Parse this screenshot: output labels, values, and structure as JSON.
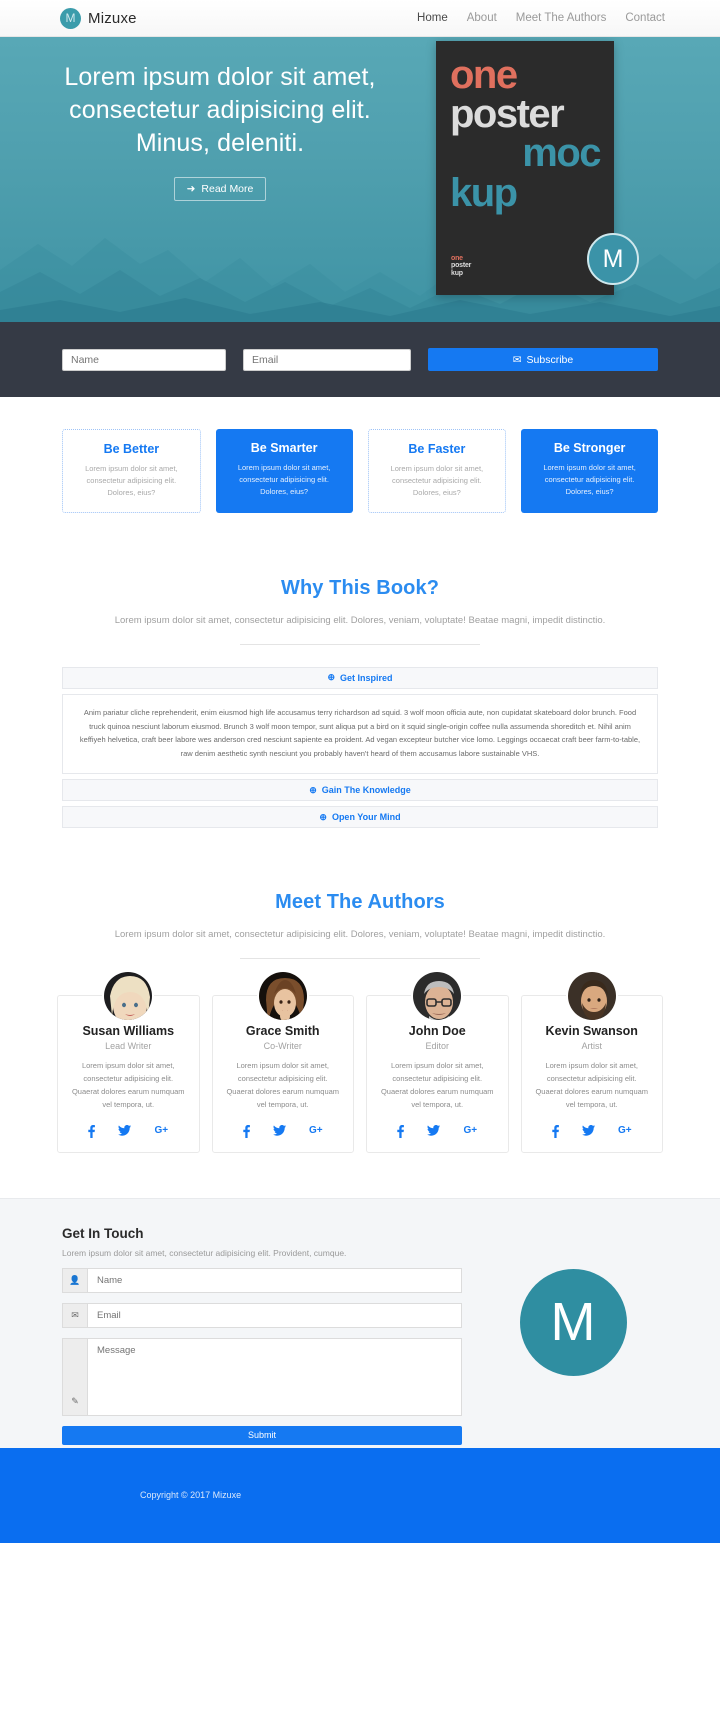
{
  "navbar": {
    "brand": "Mizuxe",
    "brand_initial": "M",
    "links": [
      {
        "label": "Home",
        "active": true
      },
      {
        "label": "About",
        "active": false
      },
      {
        "label": "Meet The Authors",
        "active": false
      },
      {
        "label": "Contact",
        "active": false
      }
    ]
  },
  "hero": {
    "title": "Lorem ipsum dolor sit amet, consectetur adipisicing elit. Minus, deleniti.",
    "cta": "Read More",
    "cta_icon": "arrow-right-icon",
    "poster": {
      "line1": "one",
      "line2": "poster",
      "line3": "moc",
      "line4": "kup",
      "mark1": "one",
      "mark2": "poster",
      "mark3": "kup",
      "badge": "M",
      "bg_color": "#2b2b2b",
      "accent_red": "#e0705e",
      "accent_teal": "#3b93a8"
    }
  },
  "subscribe": {
    "name_placeholder": "Name",
    "email_placeholder": "Email",
    "button_label": "Subscribe",
    "button_icon": "envelope-open-icon",
    "bar_color": "#353a45",
    "button_color": "#1579f2"
  },
  "features": [
    {
      "title": "Be Better",
      "text": "Lorem ipsum dolor sit amet, consectetur adipisicing elit. Dolores, eius?",
      "style": "light"
    },
    {
      "title": "Be Smarter",
      "text": "Lorem ipsum dolor sit amet, consectetur adipisicing elit. Dolores, eius?",
      "style": "solid"
    },
    {
      "title": "Be Faster",
      "text": "Lorem ipsum dolor sit amet, consectetur adipisicing elit. Dolores, eius?",
      "style": "light"
    },
    {
      "title": "Be Stronger",
      "text": "Lorem ipsum dolor sit amet, consectetur adipisicing elit. Dolores, eius?",
      "style": "solid"
    }
  ],
  "why": {
    "heading": "Why This Book?",
    "subtext": "Lorem ipsum dolor sit amet, consectetur adipisicing elit. Dolores, veniam, voluptate! Beatae magni, impedit distinctio.",
    "accordion": [
      {
        "label": "Get Inspired",
        "icon": "plus-circle-icon",
        "open": true,
        "body": "Anim pariatur cliche reprehenderit, enim eiusmod high life accusamus terry richardson ad squid. 3 wolf moon officia aute, non cupidatat skateboard dolor brunch. Food truck quinoa nesciunt laborum eiusmod. Brunch 3 wolf moon tempor, sunt aliqua put a bird on it squid single-origin coffee nulla assumenda shoreditch et. Nihil anim keffiyeh helvetica, craft beer labore wes anderson cred nesciunt sapiente ea proident. Ad vegan excepteur butcher vice lomo. Leggings occaecat craft beer farm-to-table, raw denim aesthetic synth nesciunt you probably haven't heard of them accusamus labore sustainable VHS."
      },
      {
        "label": "Gain The Knowledge",
        "icon": "plus-circle-icon",
        "open": false,
        "body": ""
      },
      {
        "label": "Open Your Mind",
        "icon": "plus-circle-icon",
        "open": false,
        "body": ""
      }
    ]
  },
  "authors_section": {
    "heading": "Meet The Authors",
    "subtext": "Lorem ipsum dolor sit amet, consectetur adipisicing elit. Dolores, veniam, voluptate! Beatae magni, impedit distinctio.",
    "authors": [
      {
        "name": "Susan Williams",
        "role": "Lead Writer",
        "bio": "Lorem ipsum dolor sit amet, consectetur adipisicing elit. Quaerat dolores earum numquam vel tempora, ut.",
        "avatar": "blonde-woman-avatar",
        "socials": [
          "facebook-icon",
          "twitter-icon",
          "google-plus-icon"
        ]
      },
      {
        "name": "Grace Smith",
        "role": "Co-Writer",
        "bio": "Lorem ipsum dolor sit amet, consectetur adipisicing elit. Quaerat dolores earum numquam vel tempora, ut.",
        "avatar": "brunette-woman-avatar",
        "socials": [
          "facebook-icon",
          "twitter-icon",
          "google-plus-icon"
        ]
      },
      {
        "name": "John Doe",
        "role": "Editor",
        "bio": "Lorem ipsum dolor sit amet, consectetur adipisicing elit. Quaerat dolores earum numquam vel tempora, ut.",
        "avatar": "older-man-glasses-avatar",
        "socials": [
          "facebook-icon",
          "twitter-icon",
          "google-plus-icon"
        ]
      },
      {
        "name": "Kevin Swanson",
        "role": "Artist",
        "bio": "Lorem ipsum dolor sit amet, consectetur adipisicing elit. Quaerat dolores earum numquam vel tempora, ut.",
        "avatar": "bearded-man-avatar",
        "socials": [
          "facebook-icon",
          "twitter-icon",
          "google-plus-icon"
        ]
      }
    ],
    "social_labels": {
      "facebook": "f",
      "twitter": "t",
      "google": "G+"
    }
  },
  "contact": {
    "heading": "Get In Touch",
    "subtext": "Lorem ipsum dolor sit amet, consectetur adipisicing elit. Provident, cumque.",
    "name_placeholder": "Name",
    "name_icon": "user-icon",
    "email_placeholder": "Email",
    "email_icon": "envelope-icon",
    "message_placeholder": "Message",
    "message_icon": "pencil-icon",
    "submit_label": "Submit",
    "logo_initial": "M",
    "logo_color": "#2f8ea1"
  },
  "footer": {
    "copyright": "Copyright © 2017 Mizuxe",
    "bg_color": "#0a6ef0"
  }
}
